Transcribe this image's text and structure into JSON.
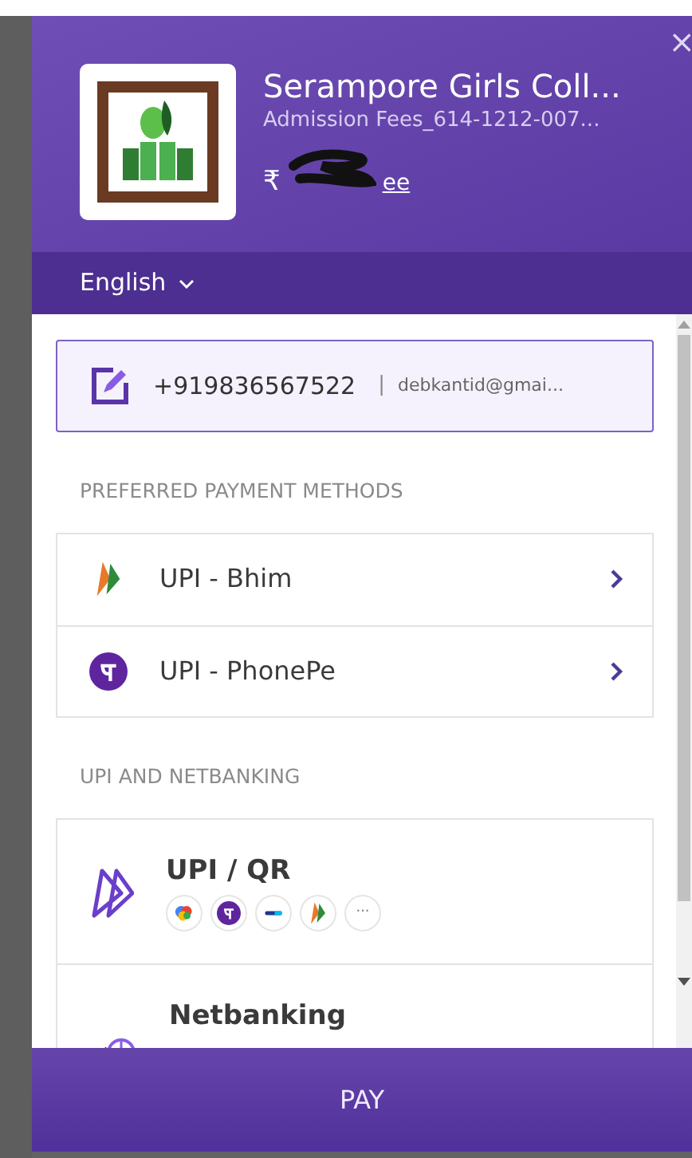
{
  "header": {
    "close": "×",
    "merchant": "Serampore Girls Coll...",
    "description": "Admission Fees_614-1212-007...",
    "amount_symbol": "₹",
    "amount_link_fragment": "ee",
    "language": "English"
  },
  "contact": {
    "phone": "+919836567522",
    "separator": "|",
    "email": "debkantid@gmai..."
  },
  "preferred": {
    "heading": "PREFERRED PAYMENT METHODS",
    "methods": [
      {
        "kind": "bhim",
        "label": "UPI - Bhim"
      },
      {
        "kind": "phonepe",
        "label": "UPI - PhonePe"
      }
    ]
  },
  "upi_netbanking": {
    "heading": "UPI AND NETBANKING",
    "options": [
      {
        "kind": "upi",
        "label": "UPI / QR",
        "apps": [
          {
            "kind": "gpay"
          },
          {
            "kind": "phonepe"
          },
          {
            "kind": "paytm"
          },
          {
            "kind": "bhim"
          },
          {
            "kind": "more",
            "text": "···"
          }
        ]
      },
      {
        "kind": "netbanking",
        "label": "Netbanking"
      }
    ]
  },
  "pay_button": "PAY"
}
